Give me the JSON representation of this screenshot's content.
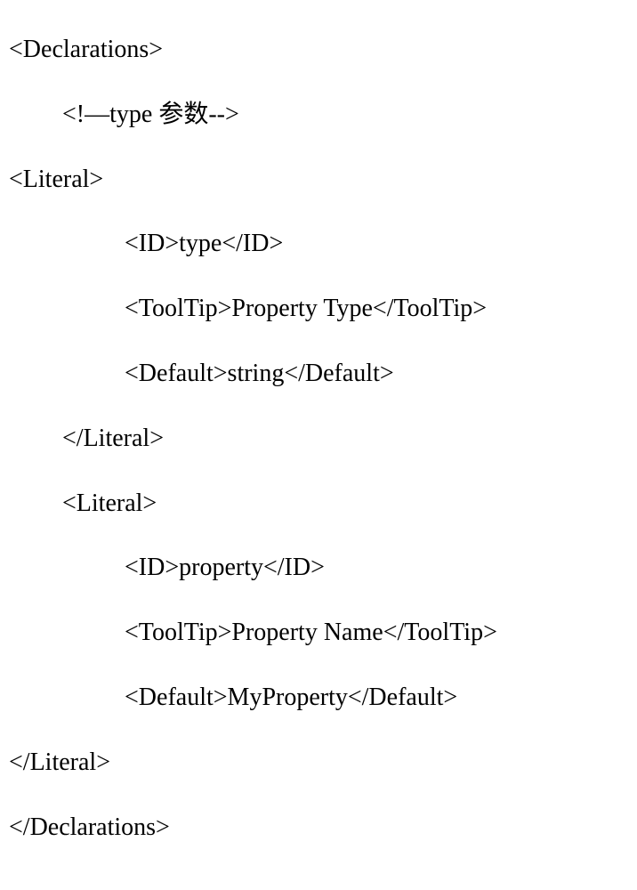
{
  "code": {
    "line1": "<Declarations>",
    "line2": "<!—type 参数-->",
    "line3": "<Literal>",
    "line4": "<ID>type</ID>",
    "line5": "<ToolTip>Property Type</ToolTip>",
    "line6": "<Default>string</Default>",
    "line7": "</Literal>",
    "line8": "<Literal>",
    "line9": "<ID>property</ID>",
    "line10": "<ToolTip>Property Name</ToolTip>",
    "line11": "<Default>MyProperty</Default>",
    "line12": "</Literal>",
    "line13": "</Declarations>"
  }
}
